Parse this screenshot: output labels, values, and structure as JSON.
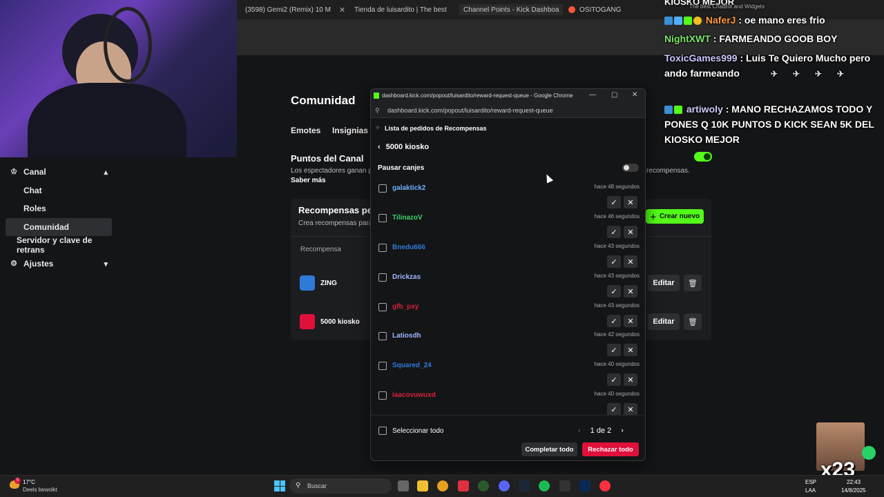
{
  "browser": {
    "tabs": [
      {
        "label": "(3598) Gemi2 (Remix) 10 M",
        "color": "#ff0000"
      },
      {
        "label": "Tienda de luisardito | The best",
        "color": "#eeeeee"
      },
      {
        "label": "Channel Points - Kick Dashboa",
        "color": "#53fc18"
      },
      {
        "label": "OSITOGANG",
        "color": "#ff5533"
      }
    ]
  },
  "sidebar": {
    "items": [
      {
        "label": "Canal"
      },
      {
        "label": "Chat"
      },
      {
        "label": "Roles"
      },
      {
        "label": "Comunidad"
      },
      {
        "label": "Servidor y clave de retrans"
      },
      {
        "label": "Ajustes"
      }
    ]
  },
  "main": {
    "title": "Comunidad",
    "tabs": [
      "Emotes",
      "Insignias d"
    ],
    "puntos_title": "Puntos del Canal",
    "puntos_desc": "Los espectadores ganan p",
    "puntos_desc_end": "recompensas.",
    "saber_mas": "Saber más",
    "rewards_title": "Recompensas per",
    "rewards_sub": "Crea recompensas para",
    "create_label": "Crear nuevo",
    "col_header": "Recompensa",
    "rewards": [
      {
        "name": "ZING",
        "color": "#2f7ad8",
        "edit": "Editar"
      },
      {
        "name": "5000 kiosko",
        "color": "#e0103a",
        "edit": "Editar"
      }
    ]
  },
  "popup": {
    "window_title": "dashboard.kick.com/popout/luisardito/reward-request-queue - Google Chrome",
    "url": "dashboard.kick.com/popout/luisardito/reward-request-queue",
    "header": "Lista de pedidos de Recompensas",
    "reward_name": "5000 kiosko",
    "pause_label": "Pausar canjes",
    "requests": [
      {
        "user": "galaktick2",
        "time": "hace 48 segundos",
        "color": "#6fb0ff"
      },
      {
        "user": "TilinazoV",
        "time": "hace 46 segundos",
        "color": "#3fd06a"
      },
      {
        "user": "Bnedu666",
        "time": "hace 43 segundos",
        "color": "#2f7ad8"
      },
      {
        "user": "Drickzas",
        "time": "hace 43 segundos",
        "color": "#9fb8ff"
      },
      {
        "user": "gfb_pxy",
        "time": "hace 43 segundos",
        "color": "#d8203a"
      },
      {
        "user": "Latiosdh",
        "time": "hace 42 segundos",
        "color": "#9fb8ff"
      },
      {
        "user": "Squared_24",
        "time": "hace 40 segundos",
        "color": "#2f7ad8"
      },
      {
        "user": "iaacovuwuxd",
        "time": "hace 40 segundos",
        "color": "#d8203a"
      }
    ],
    "select_all": "Seleccionar todo",
    "page": "1 de 2",
    "complete_all": "Completar todo",
    "reject_all": "Rechazar todo"
  },
  "chat": {
    "top_cut": "KIOSKO MEJOR",
    "tab_hint": "The best ChatBot and Widgets",
    "messages": [
      {
        "user": "NaferJ",
        "text": ": oe mano eres frio",
        "color": "#ff9a3c"
      },
      {
        "user": "NightXWT",
        "text": ": FARMEANDO GOOB BOY",
        "color": "#7de36a"
      },
      {
        "user": "ToxicGames999",
        "text": ": Luis Te Quiero Mucho pero ando farmeando",
        "color": "#c8c8ff"
      },
      {
        "user": "artiwoly",
        "text": ": MANO RECHAZAMOS TODO Y PONES Q 10K PUNTOS D KICK SEAN 5K DEL KIOSKO MEJOR",
        "color": "#ccccff"
      }
    ]
  },
  "overlay": {
    "multiplier": "x23"
  },
  "taskbar": {
    "temp": "17°C",
    "weather": "Deels bewolkt",
    "weather_badge": "5",
    "search": "Buscar",
    "lang1": "ESP",
    "lang2": "LAA",
    "time": "22:43",
    "date": "14/8/2025"
  }
}
